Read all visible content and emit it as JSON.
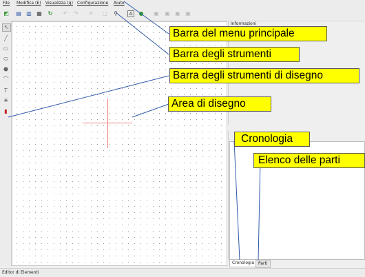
{
  "menu": [
    "File",
    "Modifica (E)",
    "Visualizza (g)",
    "Configurazione",
    "Aiuto"
  ],
  "toolbar_icons": [
    "new-icon",
    "save-icon",
    "save-as-icon",
    "save-all-icon",
    "reload-icon",
    "undo-icon",
    "redo-icon",
    "delete-icon",
    "select-all-icon",
    "zoom-icon",
    "text-icon",
    "add-icon",
    "copy-icon",
    "paste-icon",
    "cut-icon",
    "paste-area-icon"
  ],
  "drawing_tools": [
    "select-icon",
    "line-icon",
    "rectangle-icon",
    "ellipse-icon",
    "polygon-icon",
    "arc-icon",
    "text-tool-icon",
    "terminal-icon",
    "text-field-icon"
  ],
  "info_panel": {
    "title": "Informazioni"
  },
  "history_panel": {
    "title": "Cronologia"
  },
  "tabs": [
    "Cronologia",
    "Parti"
  ],
  "status": "Editor di Elementi",
  "callouts": {
    "menubar": "Barra del menu principale",
    "toolbar": "Barra degli strumenti",
    "drawtools": "Barra degli strumenti di disegno",
    "canvas": "Area di disegno",
    "history": "Cronologia",
    "parts": "Elenco delle parti"
  },
  "colors": {
    "callout_bg": "#ffff00",
    "leader": "#2f5aa8",
    "crosshair": "#f27a7a"
  }
}
